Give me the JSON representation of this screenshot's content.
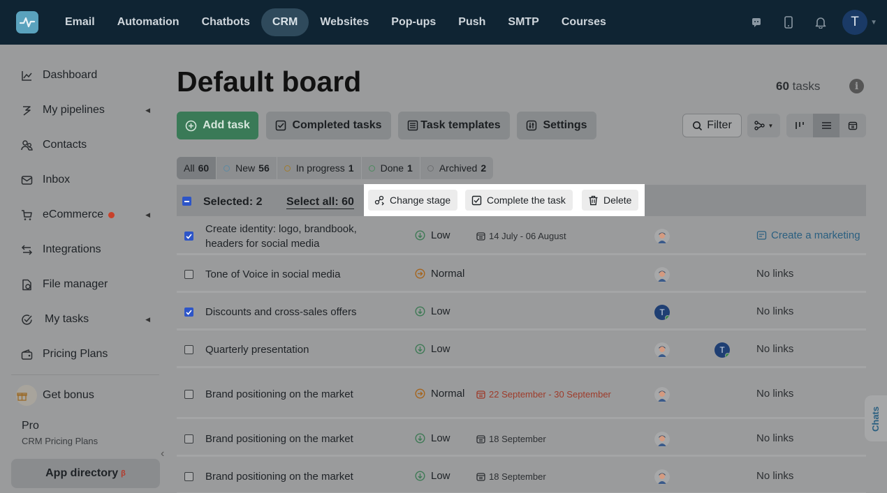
{
  "nav": {
    "items": [
      "Email",
      "Automation",
      "Chatbots",
      "CRM",
      "Websites",
      "Pop-ups",
      "Push",
      "SMTP",
      "Courses"
    ],
    "active": "CRM",
    "avatar_letter": "T"
  },
  "sidebar": {
    "items": [
      {
        "label": "Dashboard"
      },
      {
        "label": "My pipelines"
      },
      {
        "label": "Contacts"
      },
      {
        "label": "Inbox"
      },
      {
        "label": "eCommerce"
      },
      {
        "label": "Integrations"
      },
      {
        "label": "File manager"
      },
      {
        "label": "My tasks"
      },
      {
        "label": "Pricing Plans"
      },
      {
        "label": "Get bonus"
      }
    ],
    "plan_name": "Pro",
    "plan_sub": "CRM Pricing Plans",
    "app_directory": "App directory",
    "app_directory_badge": "β"
  },
  "board": {
    "title": "Default board",
    "task_count": "60",
    "task_count_label": "tasks",
    "buttons": {
      "add_task": "Add task",
      "completed": "Completed tasks",
      "templates": "Task templates",
      "settings": "Settings",
      "filter": "Filter"
    },
    "tabs": [
      {
        "label": "All",
        "count": "60"
      },
      {
        "label": "New",
        "count": "56"
      },
      {
        "label": "In progress",
        "count": "1"
      },
      {
        "label": "Done",
        "count": "1"
      },
      {
        "label": "Archived",
        "count": "2"
      }
    ]
  },
  "selection": {
    "selected_label": "Selected: 2",
    "select_all_label": "Select all: 60",
    "actions": {
      "change_stage": "Change stage",
      "complete": "Complete the task",
      "delete": "Delete"
    }
  },
  "tasks": [
    {
      "name": "Create identity: logo, brandbook, headers for social media",
      "checked": true,
      "priority": "Low",
      "date": "14 July - 06 August",
      "link": "Create a marketing"
    },
    {
      "name": "Tone of Voice in social media",
      "checked": false,
      "priority": "Normal",
      "date": "",
      "link": "No links"
    },
    {
      "name": "Discounts and cross-sales offers",
      "checked": true,
      "priority": "Low",
      "date": "",
      "link": "No links",
      "avatar_letter": "T"
    },
    {
      "name": "Quarterly presentation",
      "checked": false,
      "priority": "Low",
      "date": "",
      "link": "No links",
      "avatar_letter": "T"
    },
    {
      "name": "Brand positioning on the market",
      "checked": false,
      "priority": "Normal",
      "date": "22 September - 30 September",
      "link": "No links"
    },
    {
      "name": "Brand positioning on the market",
      "checked": false,
      "priority": "Low",
      "date": "18 September",
      "link": "No links"
    },
    {
      "name": "Brand positioning on the market",
      "checked": false,
      "priority": "Low",
      "date": "18 September",
      "link": "No links"
    }
  ],
  "chats_label": "Chats",
  "colors": {
    "topbar": "#0f2433",
    "primary_green": "#3a7a57",
    "checkbox_blue": "#2d55c8",
    "link_blue": "#2a5f80",
    "overdue_red": "#9e3b2a"
  }
}
